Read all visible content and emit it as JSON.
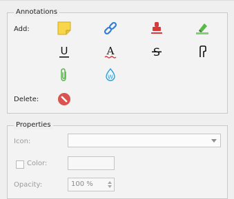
{
  "annotations": {
    "title": "Annotations",
    "add_label": "Add:",
    "delete_label": "Delete:",
    "tools": [
      {
        "name": "sticky-note-icon",
        "color": "#f7d64a"
      },
      {
        "name": "link-icon",
        "color": "#2f7ed8"
      },
      {
        "name": "stamp-icon",
        "color": "#d63b3b"
      },
      {
        "name": "highlighter-icon",
        "color": "#58b947"
      },
      {
        "name": "underline-icon",
        "color": "#111111"
      },
      {
        "name": "squiggly-underline-icon",
        "color": "#d63b3b"
      },
      {
        "name": "strikeout-icon",
        "color": "#111111"
      },
      {
        "name": "freehand-icon",
        "color": "#111111"
      },
      {
        "name": "attachment-icon",
        "color": "#58b947"
      },
      {
        "name": "watermark-icon",
        "color": "#2f9fd8"
      }
    ],
    "delete_icon": {
      "name": "delete-icon",
      "color": "#d9534f"
    }
  },
  "properties": {
    "title": "Properties",
    "icon_label": "Icon:",
    "icon_value": "",
    "color_label": "Color:",
    "color_checked": false,
    "opacity_label": "Opacity:",
    "opacity_value": "100 %"
  }
}
